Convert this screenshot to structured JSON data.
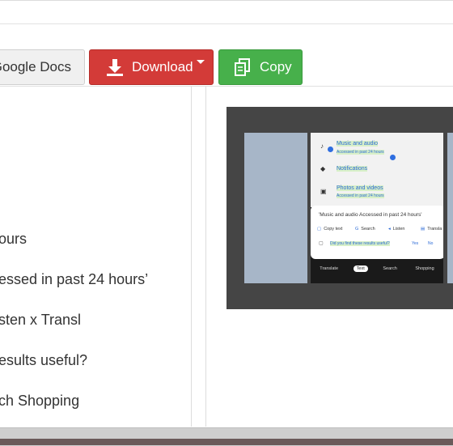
{
  "toolbar": {
    "gdocs_label": "Google Docs",
    "download_label": "Download",
    "copy_label": "Copy"
  },
  "text": {
    "lines": [
      "ours",
      "essed in past 24 hours’",
      "sten x Transl",
      "esults useful?",
      "ch Shopping"
    ]
  },
  "phone": {
    "item1": "Music and audio",
    "item1_sub": "Accessed in past 24 hours",
    "item2": "Notifications",
    "item3": "Photos and videos",
    "item3_sub": "Accessed in past 24 hours",
    "card_quote": "'Music and audio Accessed in past 24 hours'",
    "act_copy": "Copy text",
    "act_search": "Search",
    "act_listen": "Listen",
    "act_translate": "Transla",
    "question": "Did you find these results useful?",
    "yes": "Yes",
    "no": "No",
    "tabs": [
      "Translate",
      "Text",
      "Search",
      "Shopping"
    ]
  },
  "colors": {
    "download": "#d33b38",
    "copy": "#47b04b",
    "accent_blue": "#2b6ad6"
  }
}
